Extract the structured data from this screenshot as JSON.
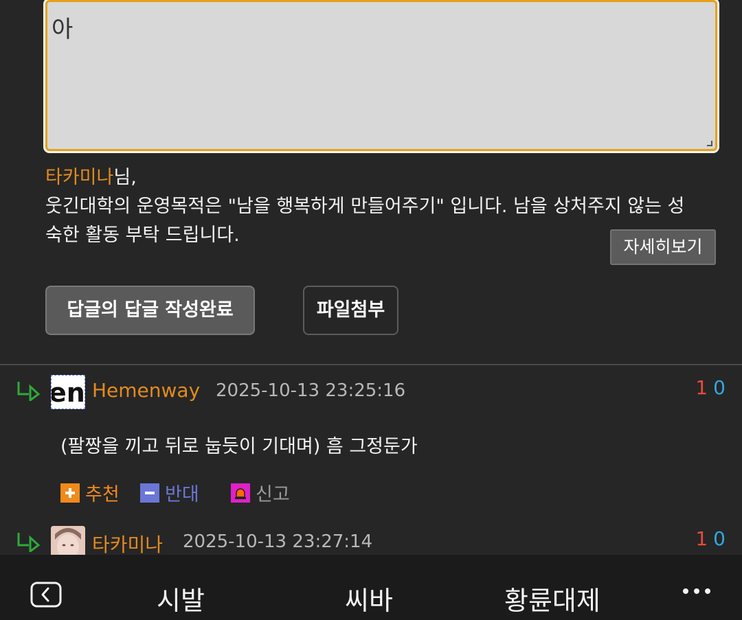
{
  "reply_box": {
    "value": "아"
  },
  "notice": {
    "username": "타카미나",
    "suffix": "님,",
    "line1": "웃긴대학의 운영목적은 \"남을 행복하게 만들어주기\" 입니다. 남을 상처주지 않는 성",
    "line2": "숙한 활동 부탁 드립니다.",
    "detail_button": "자세히보기"
  },
  "buttons": {
    "submit": "답글의 답글 작성완료",
    "attach": "파일첨부"
  },
  "comments": [
    {
      "nickname": "Hemenway",
      "datetime": "2025-10-13 23:25:16",
      "upvotes": "1",
      "downvotes": "0",
      "avatar_text": "en",
      "body": "(팔짱을 끼고 뒤로 눕듯이 기대며) 흠 그정둔가",
      "actions": {
        "recommend": "추천",
        "oppose": "반대",
        "report": "신고"
      }
    },
    {
      "nickname": "타카미나",
      "datetime": "2025-10-13 23:27:14",
      "upvotes": "1",
      "downvotes": "0"
    }
  ],
  "bottom_nav": {
    "item1": "시발",
    "item2": "씨바",
    "item3": "황륜대제"
  },
  "colors": {
    "accent_orange": "#e38b1f",
    "upvote_red": "#e74c3c",
    "downvote_blue": "#2fa8e0",
    "reply_border": "#e6a116"
  },
  "icons": [
    "reply-arrow-icon",
    "plus-icon",
    "minus-icon",
    "siren-icon",
    "back-icon",
    "more-icon"
  ]
}
